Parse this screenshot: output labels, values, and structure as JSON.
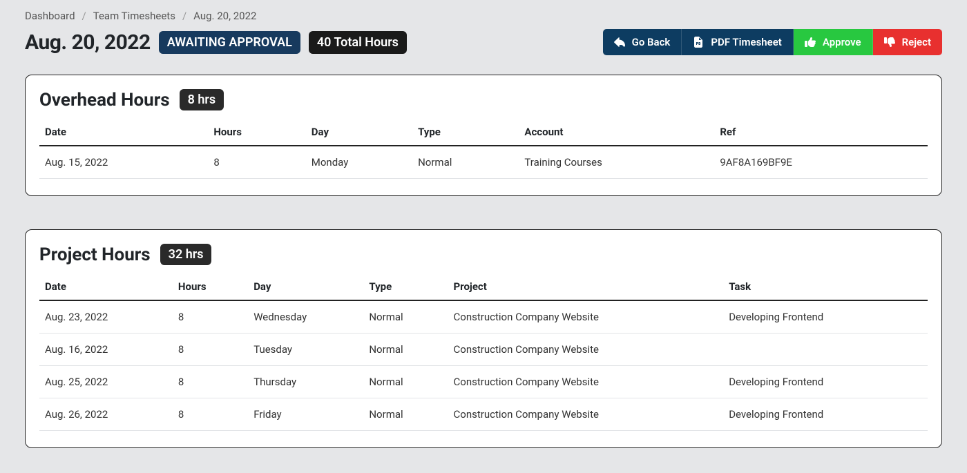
{
  "breadcrumb": {
    "items": [
      "Dashboard",
      "Team Timesheets",
      "Aug. 20, 2022"
    ]
  },
  "header": {
    "title": "Aug. 20, 2022",
    "status_badge": "AWAITING APPROVAL",
    "total_badge": "40 Total Hours",
    "buttons": {
      "go_back": "Go Back",
      "pdf": "PDF Timesheet",
      "approve": "Approve",
      "reject": "Reject"
    }
  },
  "overhead": {
    "title": "Overhead Hours",
    "summary": "8 hrs",
    "columns": [
      "Date",
      "Hours",
      "Day",
      "Type",
      "Account",
      "Ref"
    ],
    "rows": [
      {
        "date": "Aug. 15, 2022",
        "hours": "8",
        "day": "Monday",
        "type": "Normal",
        "account": "Training Courses",
        "ref": "9AF8A169BF9E"
      }
    ]
  },
  "project": {
    "title": "Project Hours",
    "summary": "32 hrs",
    "columns": [
      "Date",
      "Hours",
      "Day",
      "Type",
      "Project",
      "Task"
    ],
    "rows": [
      {
        "date": "Aug. 23, 2022",
        "hours": "8",
        "day": "Wednesday",
        "type": "Normal",
        "project": "Construction Company Website",
        "task": "Developing Frontend"
      },
      {
        "date": "Aug. 16, 2022",
        "hours": "8",
        "day": "Tuesday",
        "type": "Normal",
        "project": "Construction Company Website",
        "task": ""
      },
      {
        "date": "Aug. 25, 2022",
        "hours": "8",
        "day": "Thursday",
        "type": "Normal",
        "project": "Construction Company Website",
        "task": "Developing Frontend"
      },
      {
        "date": "Aug. 26, 2022",
        "hours": "8",
        "day": "Friday",
        "type": "Normal",
        "project": "Construction Company Website",
        "task": "Developing Frontend"
      }
    ]
  }
}
